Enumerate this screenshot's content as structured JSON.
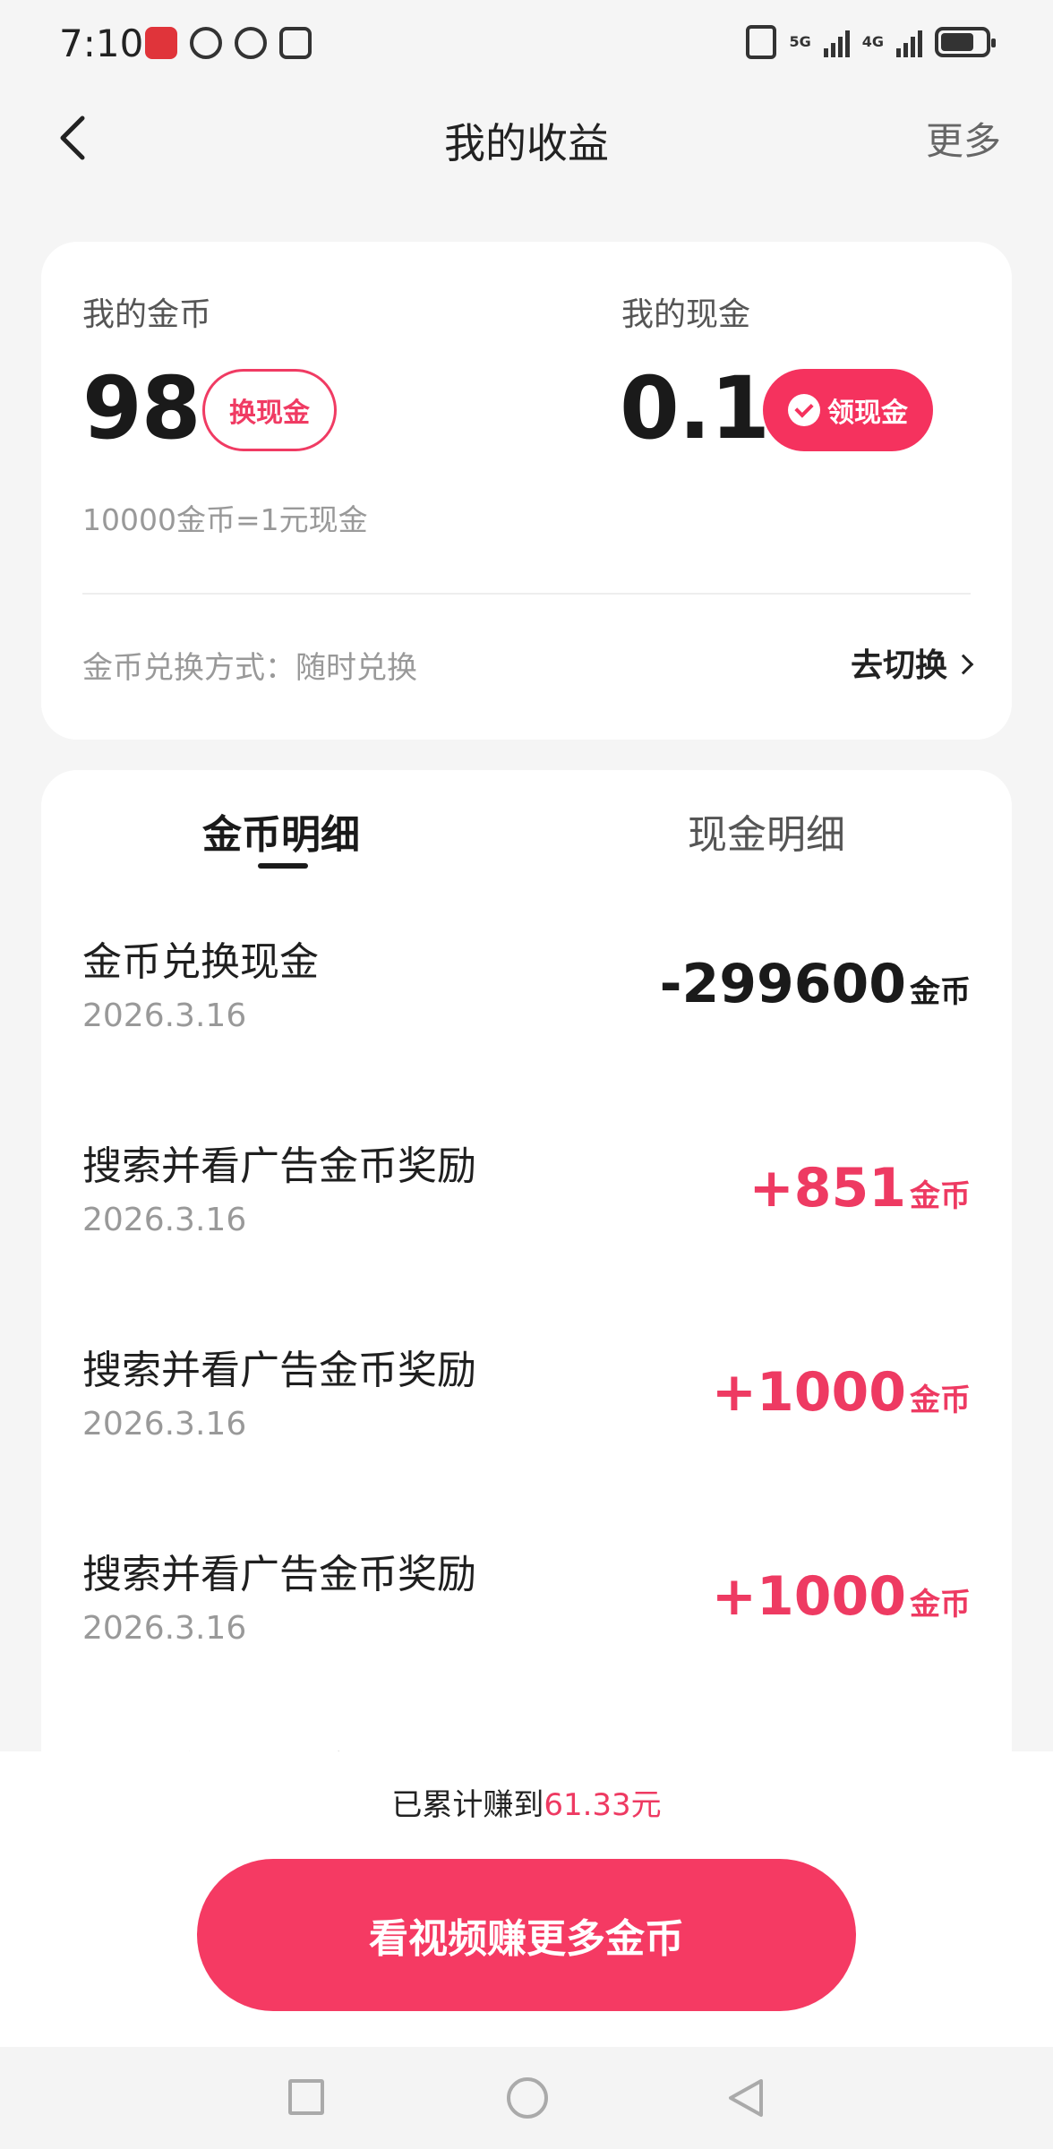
{
  "status_bar": {
    "time": "7:10",
    "net_5g": "5G",
    "net_4g": "4G",
    "battery_level": 0.75
  },
  "header": {
    "title": "我的收益",
    "more": "更多"
  },
  "summary": {
    "coins_label": "我的金币",
    "coins_value": "98",
    "exchange_button": "换现金",
    "cash_label": "我的现金",
    "cash_value": "0.1",
    "claim_button": "领现金",
    "rate_note": "10000金币=1元现金",
    "exchange_mode": "金币兑换方式：随时兑换",
    "switch_link": "去切换"
  },
  "tabs": {
    "coin_detail": "金币明细",
    "cash_detail": "现金明细"
  },
  "transactions": [
    {
      "title": "金币兑换现金",
      "date": "2026.3.16",
      "amount": "-299600",
      "unit": "金币"
    },
    {
      "title": "搜索并看广告金币奖励",
      "date": "2026.3.16",
      "amount": "+851",
      "unit": "金币"
    },
    {
      "title": "搜索并看广告金币奖励",
      "date": "2026.3.16",
      "amount": "+1000",
      "unit": "金币"
    },
    {
      "title": "搜索并看广告金币奖励",
      "date": "2026.3.16",
      "amount": "+1000",
      "unit": "金币"
    }
  ],
  "partial_row_title": "搜索并看广告金币奖励",
  "bottom": {
    "earned_prefix": "已累计赚到",
    "earned_amount": "61.33元",
    "cta": "看视频赚更多金币"
  },
  "colors": {
    "accent": "#f53a63",
    "positive": "#ee3a62",
    "background": "#f5f5f5"
  }
}
